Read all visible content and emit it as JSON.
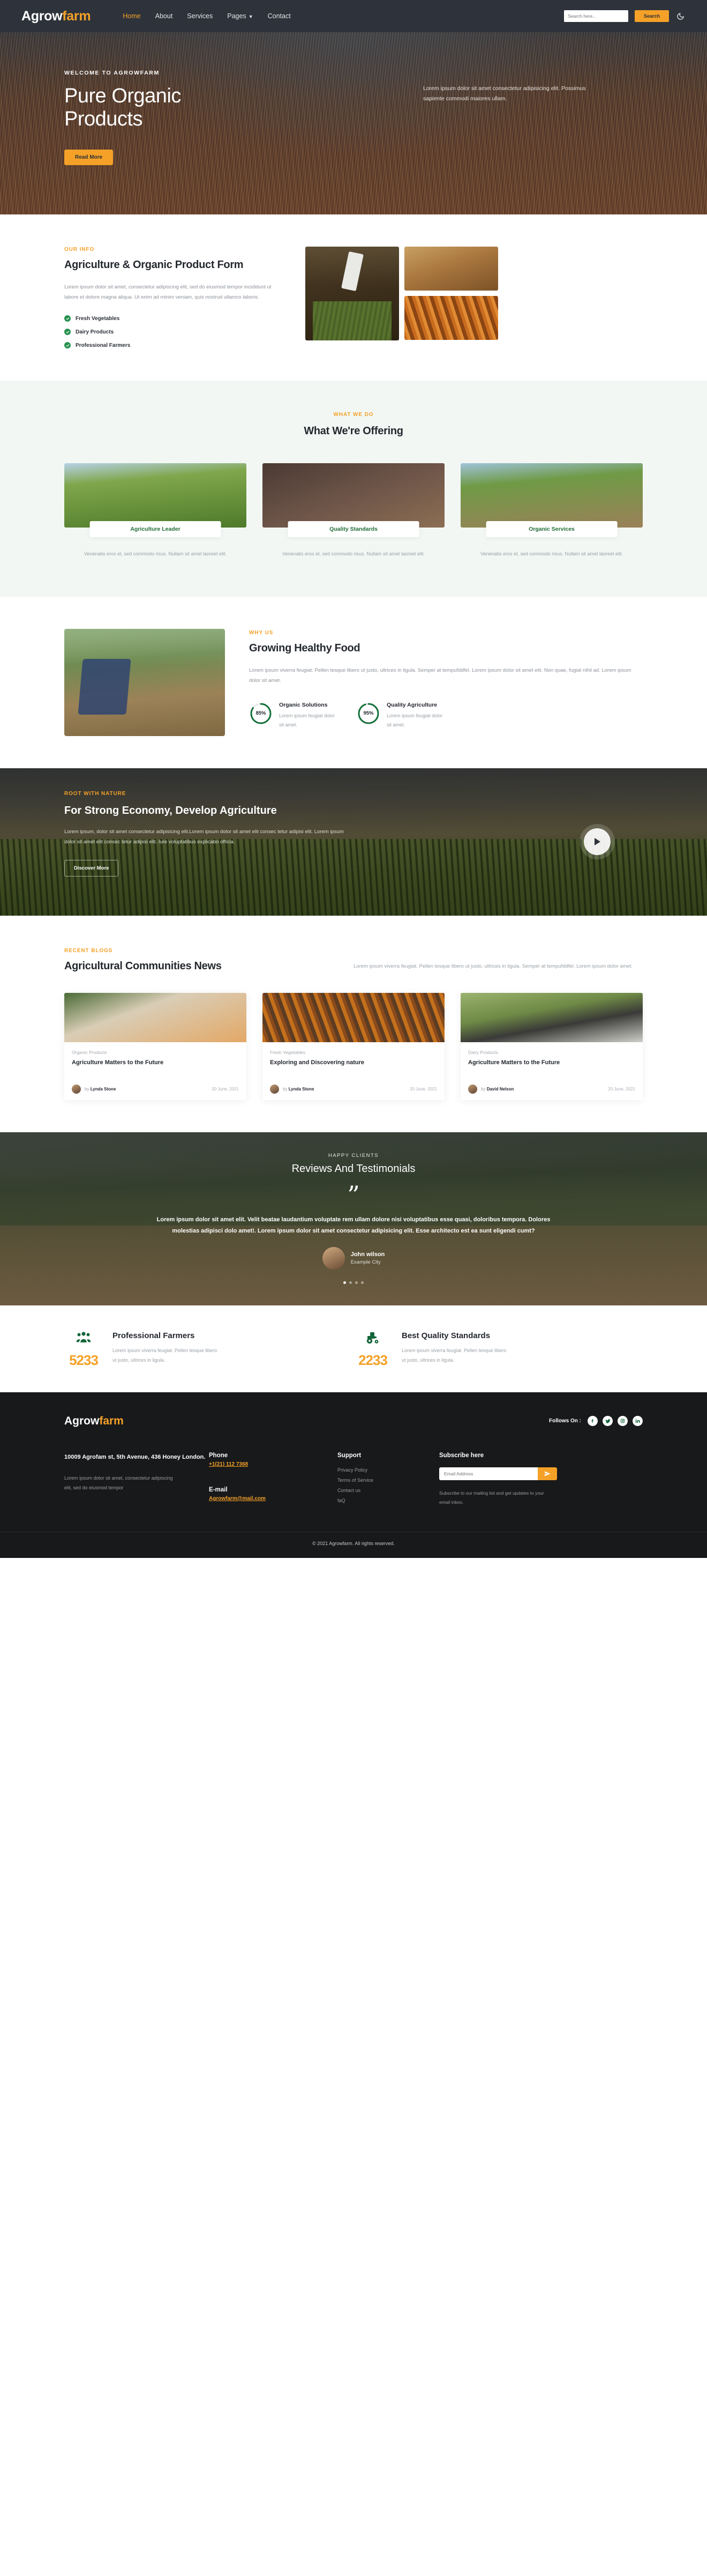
{
  "header": {
    "logo_main": "Agrow",
    "logo_accent": "farm",
    "nav": [
      {
        "label": "Home",
        "active": true
      },
      {
        "label": "About",
        "active": false
      },
      {
        "label": "Services",
        "active": false
      },
      {
        "label": "Pages",
        "active": false,
        "has_caret": true
      },
      {
        "label": "Contact",
        "active": false
      }
    ],
    "search_placeholder": "Search here...",
    "search_button": "Search",
    "theme_toggle_icon": "moon-icon"
  },
  "hero": {
    "eyebrow": "WELCOME TO AGROWFARM",
    "title_line1": "Pure Organic",
    "title_line2": "Products",
    "button": "Read More",
    "description": "Lorem ipsum dolor sit amet consectetur adipisicing elit. Possimus sapiente commodi maiores ullam."
  },
  "info": {
    "eyebrow": "OUR INFO",
    "title": "Agriculture & Organic Product Form",
    "description": "Lorem ipsum dolor sit amet, consectetur adipiscing elit, sed do eiusmod tempor incididunt ut labore et dolore magna aliqua. Ut enim ad minim veniam, quis nostrud ullamco laboris.",
    "checks": [
      "Fresh Vegetables",
      "Dairy Products",
      "Professional Farmers"
    ]
  },
  "offering": {
    "eyebrow": "WHAT WE DO",
    "title": "What We're Offering",
    "cards": [
      {
        "label": "Agriculture Leader",
        "desc": "Venenatis eros et, sed commodo risus. Nullam sit amet laoreet elit."
      },
      {
        "label": "Quality Standards",
        "desc": "Venenatis eros et, sed commodo risus. Nullam sit amet laoreet elit."
      },
      {
        "label": "Organic Services",
        "desc": "Venenatis eros et, sed commodo risus. Nullam sit amet laoreet elit."
      }
    ]
  },
  "growing": {
    "eyebrow": "WHY US",
    "title": "Growing Healthy Food",
    "description": "Lorem ipsum viverra feugiat. Pellen tesque libero ut justo, ultrices in ligula. Semper at tempufddfel. Lorem ipsum dolor sit amet elit. Non quae, fugiat nihil ad. Lorem ipsum dolor sit amet.",
    "stats": [
      {
        "percent": "85%",
        "value": 85,
        "title": "Organic Solutions",
        "desc": "Lorem ipsum feugiat dolor sit amet."
      },
      {
        "percent": "95%",
        "value": 95,
        "title": "Quality Agriculture",
        "desc": "Lorem ipsum feugiat dolor sit amet."
      }
    ]
  },
  "nature": {
    "eyebrow": "ROOT WITH NATURE",
    "title": "For Strong Economy, Develop Agriculture",
    "description": "Lorem ipsum, dolor sit amet consectetur adipisicing elit.Lorem ipsum dolor sit amet elit consec tetur adipisi elit. Lorem ipsum dolor sit amet elit consec tetur adipisi elit. Iure voluptatibus explicabo officia.",
    "button": "Discover More",
    "play_icon": "play-icon"
  },
  "blogs": {
    "eyebrow": "RECENT BLOGS",
    "title": "Agricultural Communities News",
    "description": "Lorem ipsum viverra feugiat. Pellen tesque libero ut justo, ultrices in ligula. Semper at tempufddfel. Lorem ipsum dolor amet.",
    "posts": [
      {
        "category": "Organic Products",
        "title": "Agriculture Matters to the Future",
        "by": "by",
        "author": "Lynda Stone",
        "date": "20 June, 2021"
      },
      {
        "category": "Fresh Vegetables",
        "title": "Exploring and Discovering nature",
        "by": "by",
        "author": "Lynda Stone",
        "date": "20 June, 2021"
      },
      {
        "category": "Dairy Products",
        "title": "Agriculture Matters to the Future",
        "by": "by",
        "author": "David Nelson",
        "date": "20 June, 2021"
      }
    ]
  },
  "testimonials": {
    "eyebrow": "HAPPY CLIENTS",
    "title": "Reviews And Testimonials",
    "quote": "Lorem ipsum dolor sit amet elit. Velit beatae laudantium voluptate rem ullam dolore nisi voluptatibus esse quasi, doloribus tempora. Dolores molestias adipisci dolo amet!. Lorem ipsum dolor sit amet consectetur adipisicing elit. Esse architecto est ea sunt eligendi cumt?",
    "name": "John wilson",
    "city": "Example City",
    "dot_count": 4,
    "active_dot": 0
  },
  "counters": [
    {
      "icon": "people-icon",
      "number": "5233",
      "title": "Professional Farmers",
      "desc": "Lorem ipsum viverra feugiat. Pellen tesque libero ut justo, ultrices in ligula."
    },
    {
      "icon": "tractor-icon",
      "number": "2233",
      "title": "Best Quality Standards",
      "desc": "Lorem ipsum viverra feugiat. Pellen tesque libero ut justo, ultrices in ligula."
    }
  ],
  "footer": {
    "logo_main": "Agrow",
    "logo_accent": "farm",
    "follows_label": "Follows On :",
    "socials": [
      "facebook-icon",
      "twitter-icon",
      "instagram-icon",
      "linkedin-icon"
    ],
    "address": "10009 Agrofam st, 5th Avenue, 436 Honey London.",
    "address_sub": "Lorem ipsum dolor sit amet, consectetur adipiscing elit, sed do eiusmod tempor",
    "phone_label": "Phone",
    "phone_value": "+1(21) 112 7368",
    "email_label": "E-mail",
    "email_value": "Agrowfarm@mail.com",
    "support_label": "Support",
    "support_links": [
      "Privacy Policy",
      "Terms of Service",
      "Contact us",
      "faQ"
    ],
    "subscribe_label": "Subscribe here",
    "subscribe_placeholder": "Email Address",
    "subscribe_icon": "send-icon",
    "subscribe_note": "Subscribe to our mailing list and get updates to your email inbox.",
    "copyright": "© 2021 Agrowfarm. All rights reserved."
  },
  "colors": {
    "accent": "#f5a128",
    "green": "#1f6b34",
    "dark": "#2e333b",
    "footer_bg": "#18191a"
  }
}
